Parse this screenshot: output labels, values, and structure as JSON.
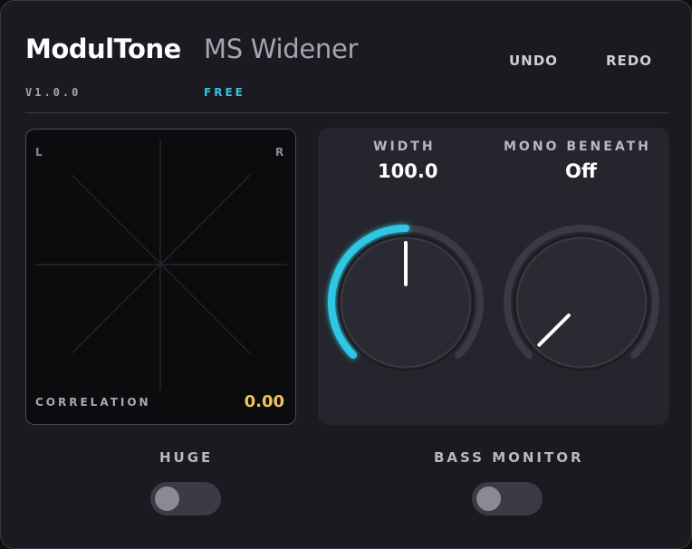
{
  "header": {
    "brand": "ModulTone",
    "product": "MS Widener",
    "undo_label": "UNDO",
    "redo_label": "REDO",
    "version": "V1.0.0",
    "edition": "FREE"
  },
  "scope": {
    "left_label": "L",
    "right_label": "R",
    "correlation_label": "CORRELATION",
    "correlation_value": "0.00"
  },
  "knobs": {
    "width": {
      "label": "WIDTH",
      "value": "100.0",
      "fraction": 0.5
    },
    "mono_beneath": {
      "label": "MONO BENEATH",
      "value": "Off",
      "fraction": 0.0
    }
  },
  "toggles": {
    "huge": {
      "label": "HUGE",
      "on": false
    },
    "bass_monitor": {
      "label": "BASS MONITOR",
      "on": false
    }
  },
  "colors": {
    "accent": "#2ec8e4",
    "correlation": "#f2c35a",
    "panel": "#1a1a20"
  }
}
